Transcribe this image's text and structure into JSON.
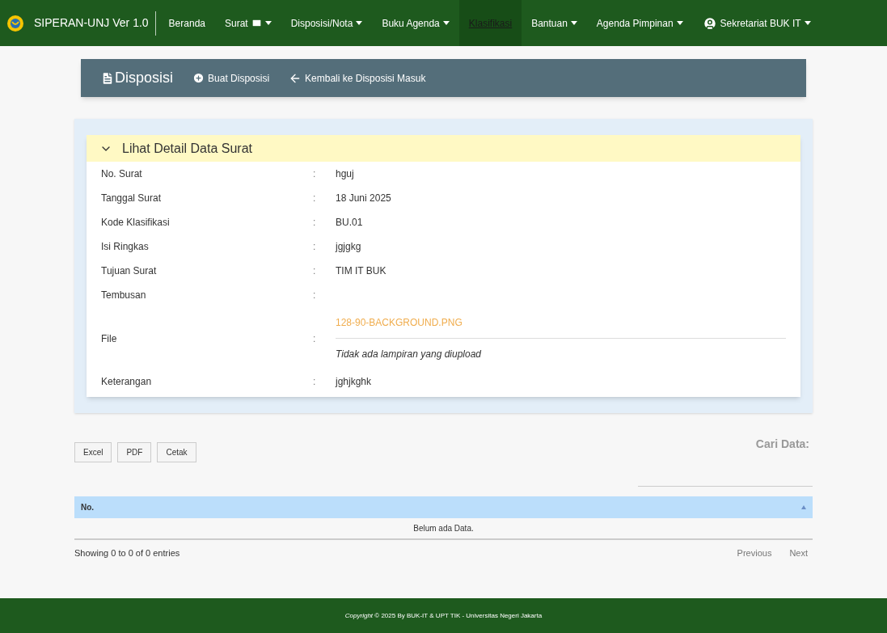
{
  "navbar": {
    "brand": "SIPERAN-UNJ Ver 1.0",
    "items": [
      {
        "label": "Beranda",
        "kind": "plain",
        "selected": false
      },
      {
        "label": "Surat",
        "kind": "mail",
        "selected": false
      },
      {
        "label": "Disposisi/Nota",
        "kind": "dropdown",
        "selected": false
      },
      {
        "label": "Buku Agenda",
        "kind": "dropdown",
        "selected": false
      },
      {
        "label": "Klasifikasi",
        "kind": "plain",
        "selected": true
      },
      {
        "label": "Bantuan",
        "kind": "dropdown",
        "selected": false
      },
      {
        "label": "Agenda Pimpinan",
        "kind": "dropdown",
        "selected": false
      },
      {
        "label": "Sekretariat BUK IT",
        "kind": "user",
        "selected": false
      }
    ]
  },
  "page_header": {
    "title": "Disposisi",
    "actions": [
      {
        "label": "Buat Disposisi",
        "kind": "add"
      },
      {
        "label": "Kembali ke Disposisi Masuk",
        "kind": "back"
      }
    ]
  },
  "detail": {
    "title": "Lihat Detail Data Surat",
    "expanded": true,
    "separator": ":",
    "rows": [
      {
        "label": "No. Surat",
        "kind": "text",
        "value": "hguj"
      },
      {
        "label": "Tanggal Surat",
        "kind": "text",
        "value": "18 Juni 2025"
      },
      {
        "label": "Kode Klasifikasi",
        "kind": "text",
        "value": "BU.01"
      },
      {
        "label": "Isi Ringkas",
        "kind": "text",
        "value": "jgjgkg"
      },
      {
        "label": "Tujuan Surat",
        "kind": "text",
        "value": "TIM IT BUK"
      },
      {
        "label": "Tembusan",
        "kind": "text"
      },
      {
        "label": "File",
        "kind": "file",
        "link": "128-90-BACKGROUND.PNG",
        "note": "Tidak ada lampiran yang diupload"
      },
      {
        "label": "Keterangan",
        "kind": "text",
        "value": "jghjkghk"
      }
    ]
  },
  "table": {
    "buttons": [
      "Excel",
      "PDF",
      "Cetak"
    ],
    "search_label": "Cari Data:",
    "columns": [
      "No."
    ],
    "empty_message": "Belum ada Data.",
    "info": "Showing 0 to 0 of 0 entries",
    "pagination": [
      "Previous",
      "Next"
    ]
  },
  "footer": "*Copyright* © 2025 By BUK-IT & UPT TIK - Universitas Negeri Jakarta"
}
